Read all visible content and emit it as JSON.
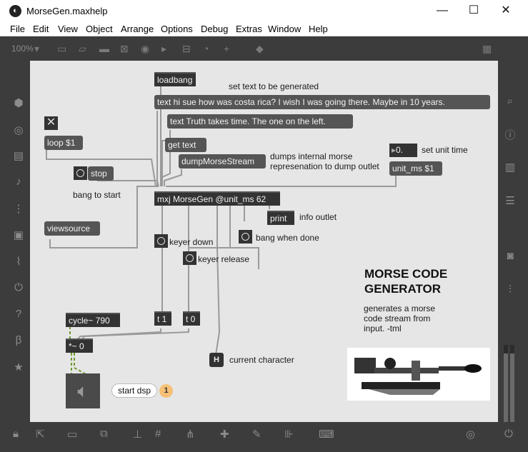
{
  "window": {
    "title": "MorseGen.maxhelp",
    "min_icon": "minimize-icon",
    "max_icon": "maximize-icon",
    "close_icon": "close-icon"
  },
  "menu": [
    "File",
    "Edit",
    "View",
    "Object",
    "Arrange",
    "Options",
    "Debug",
    "Extras",
    "Window",
    "Help"
  ],
  "toolbar": {
    "zoom": "100%"
  },
  "patch": {
    "loadbang": "loadbang",
    "set_text_comment": "set text to be generated",
    "msg_text1": "text hi sue how was costa rica? I wish I was going there. Maybe in 10 years.",
    "msg_text2": "text Truth takes time. The one on the left.",
    "msg_loop": "loop $1",
    "msg_get_text": "get text",
    "msg_dump": "dumpMorseStream",
    "dump_comment_1": "dumps internal morse",
    "dump_comment_2": "represenation to dump outlet",
    "numbox_value": "0.",
    "set_unit_comment": "set unit time",
    "msg_unit_ms": "unit_ms $1",
    "msg_stop": "stop",
    "bang_start_comment": "bang to start",
    "obj_main": "mxj MorseGen @unit_ms 62",
    "obj_print": "print",
    "info_outlet_comment": "info outlet",
    "msg_viewsource": "viewsource",
    "keyer_down_comment": "keyer down",
    "bang_done_comment": "bang when done",
    "keyer_release_comment": "keyer release",
    "heading_line1": "MORSE CODE",
    "heading_line2": "GENERATOR",
    "desc_1": "generates a morse",
    "desc_2": "code stream from",
    "desc_3": "input. -tml",
    "obj_cycle": "cycle~ 790",
    "obj_t1": "t 1",
    "obj_t0": "t 0",
    "obj_mul": "*~ 0",
    "h_label": "H",
    "current_char_comment": "current character",
    "start_dsp": "start dsp",
    "badge": "1"
  },
  "colors": {
    "canvas": "#e6e6e6",
    "object": "#333333",
    "message": "#555555",
    "chrome": "#3c3c3c",
    "badge": "#f6c177"
  }
}
